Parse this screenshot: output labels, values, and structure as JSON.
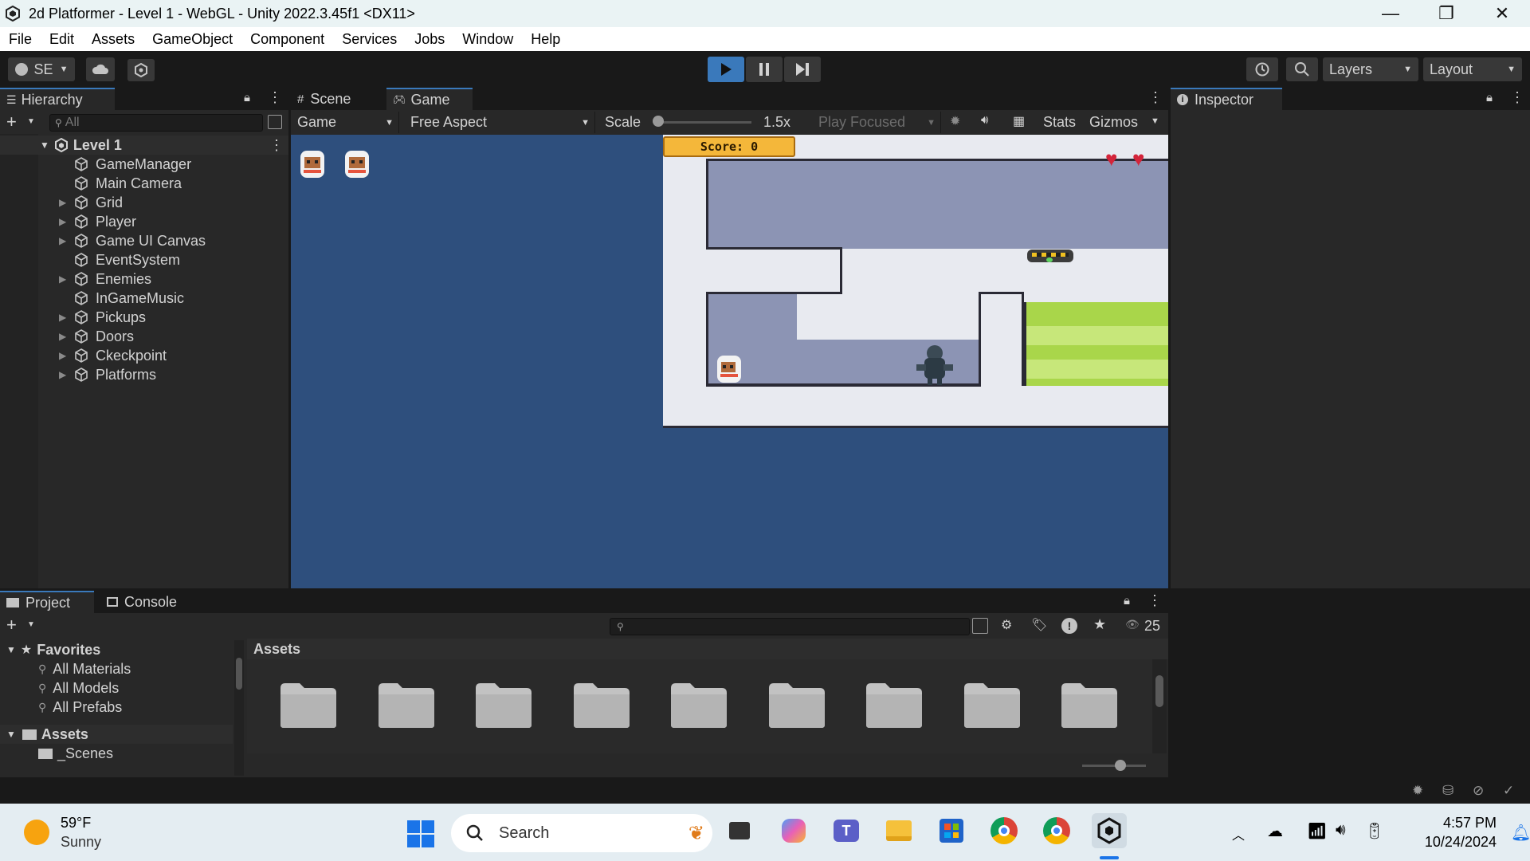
{
  "window": {
    "title": "2d Platformer - Level 1 - WebGL - Unity 2022.3.45f1 <DX11>",
    "minimize": "—",
    "restore": "❐",
    "close": "✕"
  },
  "menu": [
    "File",
    "Edit",
    "Assets",
    "GameObject",
    "Component",
    "Services",
    "Jobs",
    "Window",
    "Help"
  ],
  "toolbar": {
    "account": "SE",
    "layers": "Layers",
    "layout": "Layout"
  },
  "hierarchy": {
    "tab": "Hierarchy",
    "search_placeholder": "All",
    "scene": "Level 1",
    "items": [
      {
        "label": "GameManager",
        "expandable": false
      },
      {
        "label": "Main Camera",
        "expandable": false
      },
      {
        "label": "Grid",
        "expandable": true
      },
      {
        "label": "Player",
        "expandable": true
      },
      {
        "label": "Game UI Canvas",
        "expandable": true
      },
      {
        "label": "EventSystem",
        "expandable": false
      },
      {
        "label": "Enemies",
        "expandable": true
      },
      {
        "label": "InGameMusic",
        "expandable": false
      },
      {
        "label": "Pickups",
        "expandable": true
      },
      {
        "label": "Doors",
        "expandable": true
      },
      {
        "label": "Ckeckpoint",
        "expandable": true
      },
      {
        "label": "Platforms",
        "expandable": true
      }
    ]
  },
  "center_tabs": {
    "scene": "Scene",
    "game": "Game"
  },
  "game_toolbar": {
    "display": "Game",
    "aspect": "Free Aspect",
    "scale_label": "Scale",
    "scale_value": "1.5x",
    "play_mode": "Play Focused",
    "stats": "Stats",
    "gizmos": "Gizmos"
  },
  "game": {
    "score_text": "Score: 0",
    "hearts": 2
  },
  "inspector": {
    "tab": "Inspector"
  },
  "project": {
    "tab_project": "Project",
    "tab_console": "Console",
    "hidden_count": "25",
    "favorites_label": "Favorites",
    "favorites": [
      "All Materials",
      "All Models",
      "All Prefabs"
    ],
    "assets_label": "Assets",
    "assets_children": [
      "_Scenes"
    ],
    "breadcrumb": "Assets",
    "folder_count": 9
  },
  "taskbar": {
    "weather_temp": "59°F",
    "weather_desc": "Sunny",
    "search": "Search",
    "time": "4:57 PM",
    "date": "10/24/2024"
  },
  "colors": {
    "accent": "#3a79bb",
    "game_bg": "#2e4f7d",
    "panel": "#282828",
    "heart": "#d3243a",
    "grass": "#a9d64a"
  }
}
